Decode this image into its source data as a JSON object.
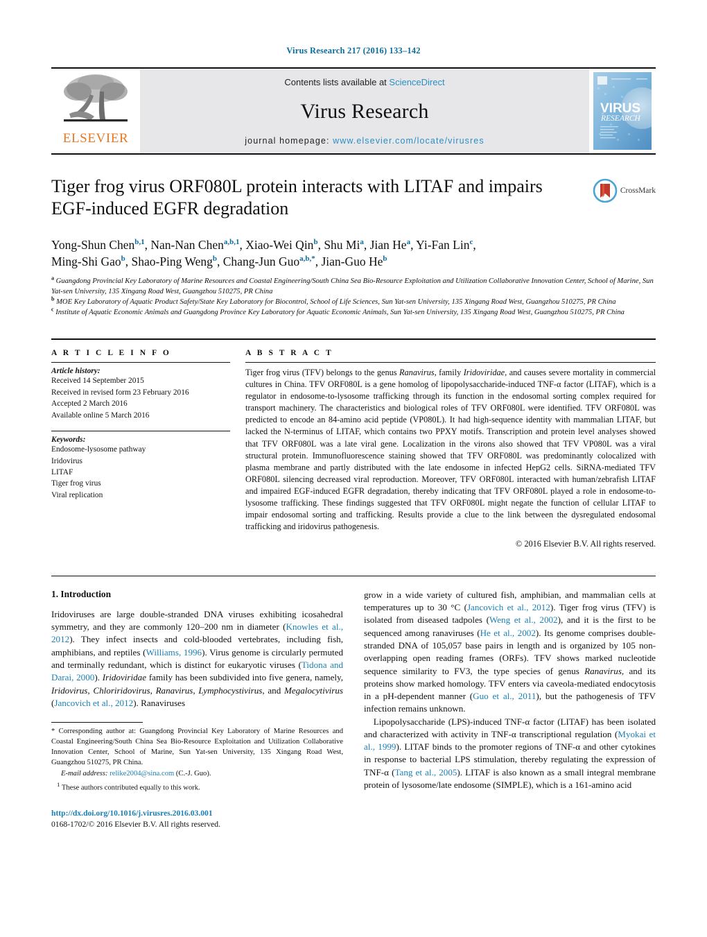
{
  "running_head": "Virus Research 217 (2016) 133–142",
  "masthead": {
    "publisher_name": "ELSEVIER",
    "contents_prefix": "Contents lists available at ",
    "sciencedirect": "ScienceDirect",
    "journal_name": "Virus Research",
    "homepage_prefix": "journal homepage: ",
    "homepage_url": "www.elsevier.com/locate/virusres",
    "cover_title_line1": "VIRUS",
    "cover_title_line2": "RESEARCH",
    "accent_link": "#2b8fc4",
    "accent_orange": "#E87722"
  },
  "article": {
    "title": "Tiger frog virus ORF080L protein interacts with LITAF and impairs EGF-induced EGFR degradation",
    "crossmark_label": "CrossMark",
    "authors_line1_html": "Yong-Shun Chen<sup>b,1</sup>, Nan-Nan Chen<sup>a,b,1</sup>, Xiao-Wei Qin<sup>b</sup>, Shu Mi<sup>a</sup>, Jian He<sup>a</sup>, Yi-Fan Lin<sup>c</sup>,",
    "authors_line2_html": "Ming-Shi Gao<sup>b</sup>, Shao-Ping Weng<sup>b</sup>, Chang-Jun Guo<sup>a,b,<span class=\"star\">*</span></sup>, Jian-Guo He<sup>b</sup>",
    "affiliations": [
      {
        "marker": "a",
        "text": "Guangdong Provincial Key Laboratory of Marine Resources and Coastal Engineering/South China Sea Bio-Resource Exploitation and Utilization Collaborative Innovation Center, School of Marine, Sun Yat-sen University, 135 Xingang Road West, Guangzhou 510275, PR China"
      },
      {
        "marker": "b",
        "text": "MOE Key Laboratory of Aquatic Product Safety/State Key Laboratory for Biocontrol, School of Life Sciences, Sun Yat-sen University, 135 Xingang Road West, Guangzhou 510275, PR China"
      },
      {
        "marker": "c",
        "text": "Institute of Aquatic Economic Animals and Guangdong Province Key Laboratory for Aquatic Economic Animals, Sun Yat-sen University, 135 Xingang Road West, Guangzhou 510275, PR China"
      }
    ]
  },
  "article_info": {
    "heading": "A R T I C L E    I N F O",
    "history_label": "Article history:",
    "history": [
      "Received 14 September 2015",
      "Received in revised form 23 February 2016",
      "Accepted 2 March 2016",
      "Available online 5 March 2016"
    ],
    "keywords_label": "Keywords:",
    "keywords": [
      "Endosome-lysosome pathway",
      "Iridovirus",
      "LITAF",
      "Tiger frog virus",
      "Viral replication"
    ]
  },
  "abstract": {
    "heading": "A B S T R A C T",
    "body_html": "Tiger frog virus (TFV) belongs to the genus <i>Ranavirus</i>, family <i>Iridoviridae</i>, and causes severe mortality in commercial cultures in China. TFV ORF080L is a gene homolog of lipopolysaccharide-induced TNF-&#945; factor (LITAF), which is a regulator in endosome-to-lysosome trafficking through its function in the endosomal sorting complex required for transport machinery. The characteristics and biological roles of TFV ORF080L were identified. TFV ORF080L was predicted to encode an 84-amino acid peptide (VP080L). It had high-sequence identity with mammalian LITAF, but lacked the N-terminus of LITAF, which contains two PPXY motifs. Transcription and protein level analyses showed that TFV ORF080L was a late viral gene. Localization in the virons also showed that TFV VP080L was a viral structural protein. Immunofluorescence staining showed that TFV ORF080L was predominantly colocalized with plasma membrane and partly distributed with the late endosome in infected HepG2 cells. SiRNA-mediated TFV ORF080L silencing decreased viral reproduction. Moreover, TFV ORF080L interacted with human/zebrafish LITAF and impaired EGF-induced EGFR degradation, thereby indicating that TFV ORF080L played a role in endosome-to-lysosome trafficking. These findings suggested that TFV ORF080L might negate the function of cellular LITAF to impair endosomal sorting and trafficking. Results provide a clue to the link between the dysregulated endosomal trafficking and iridovirus pathogenesis.",
    "copyright": "© 2016 Elsevier B.V. All rights reserved."
  },
  "introduction": {
    "heading": "1.  Introduction",
    "left_paragraph_html": "Iridoviruses are large double-stranded DNA viruses exhibiting icosahedral symmetry, and they are commonly 120–200 nm in diameter (<span class=\"ref\">Knowles et al., 2012</span>). They infect insects and cold-blooded vertebrates, including fish, amphibians, and reptiles (<span class=\"ref\">Williams, 1996</span>). Virus genome is circularly permuted and terminally redundant, which is distinct for eukaryotic viruses (<span class=\"ref\">Tidona and Darai, 2000</span>). <i>Iridoviridae</i> family has been subdivided into five genera, namely, <i>Iridovirus</i>, <i>Chloriridovirus</i>, <i>Ranavirus</i>, <i>Lymphocystivirus</i>, and <i>Megalocytivirus</i> (<span class=\"ref\">Jancovich et al., 2012</span>). Ranaviruses",
    "right_paragraph1_html": "grow in a wide variety of cultured fish, amphibian, and mammalian cells at temperatures up to 30 °C (<span class=\"ref\">Jancovich et al., 2012</span>). Tiger frog virus (TFV) is isolated from diseased tadpoles (<span class=\"ref\">Weng et al., 2002</span>), and it is the first to be sequenced among ranaviruses (<span class=\"ref\">He et al., 2002</span>). Its genome comprises double-stranded DNA of 105,057 base pairs in length and is organized by 105 non-overlapping open reading frames (ORFs). TFV shows marked nucleotide sequence similarity to FV3, the type species of genus <i>Ranavirus</i>, and its proteins show marked homology. TFV enters via caveola-mediated endocytosis in a pH-dependent manner (<span class=\"ref\">Guo et al., 2011</span>), but the pathogenesis of TFV infection remains unknown.",
    "right_paragraph2_html": "Lipopolysaccharide (LPS)-induced TNF-&#945; factor (LITAF) has been isolated and characterized with activity in TNF-&#945; transcriptional regulation (<span class=\"ref\">Myokai et al., 1999</span>). LITAF binds to the promoter regions of TNF-&#945; and other cytokines in response to bacterial LPS stimulation, thereby regulating the expression of TNF-&#945; (<span class=\"ref\">Tang et al., 2005</span>). LITAF is also known as a small integral membrane protein of lysosome/late endosome (SIMPLE), which is a 161-amino acid"
  },
  "footnotes": {
    "corresponding_html": "<span class=\"mark\">*</span>  Corresponding author at: Guangdong Provincial Key Laboratory of Marine Resources and Coastal Engineering/South China Sea Bio-Resource Exploitation and Utilization Collaborative Innovation Center, School of Marine, Sun Yat-sen University, 135 Xingang Road West, Guangzhou 510275, PR China.",
    "email_label": "E-mail address:",
    "email": "relike2004@sina.com",
    "email_suffix": "(C.-J. Guo).",
    "equal_contrib_html": "<sup>1</sup>  These authors contributed equally to this work.",
    "doi": "http://dx.doi.org/10.1016/j.virusres.2016.03.001",
    "issn_line": "0168-1702/© 2016 Elsevier B.V. All rights reserved."
  }
}
